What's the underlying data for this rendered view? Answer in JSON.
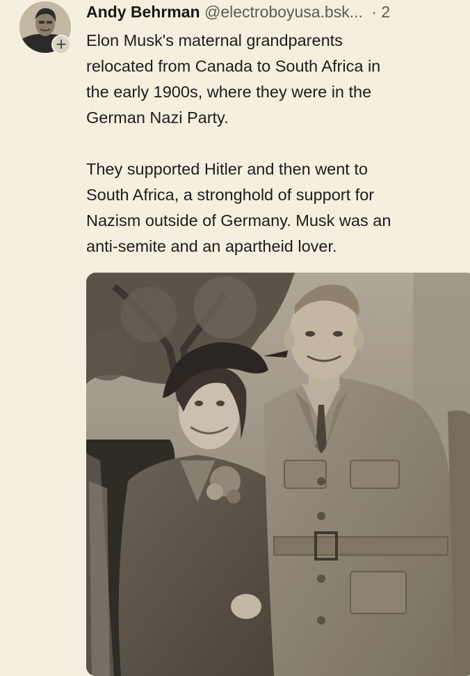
{
  "post": {
    "author_name": "Andy Behrman",
    "handle": "@electroboyusa.bsk...",
    "separator": "·",
    "timestamp": "2",
    "follow_badge": "+",
    "paragraph1": [
      "Elon Musk's maternal grandparents",
      "relocated from Canada to South Africa in",
      "the early 1900s, where they were in the",
      "German Nazi Party."
    ],
    "paragraph2": [
      "They supported Hitler and then went to",
      "South Africa, a stronghold of support for",
      "Nazism outside of Germany. Musk was an",
      "anti-semite and an apartheid lover."
    ]
  },
  "icons": {
    "follow": "plus-icon",
    "avatar": "user-avatar"
  },
  "colors": {
    "background": "#f5efe0",
    "text": "#1c1b19",
    "muted": "#5c5a55",
    "photo_tone": "#8a8477"
  }
}
